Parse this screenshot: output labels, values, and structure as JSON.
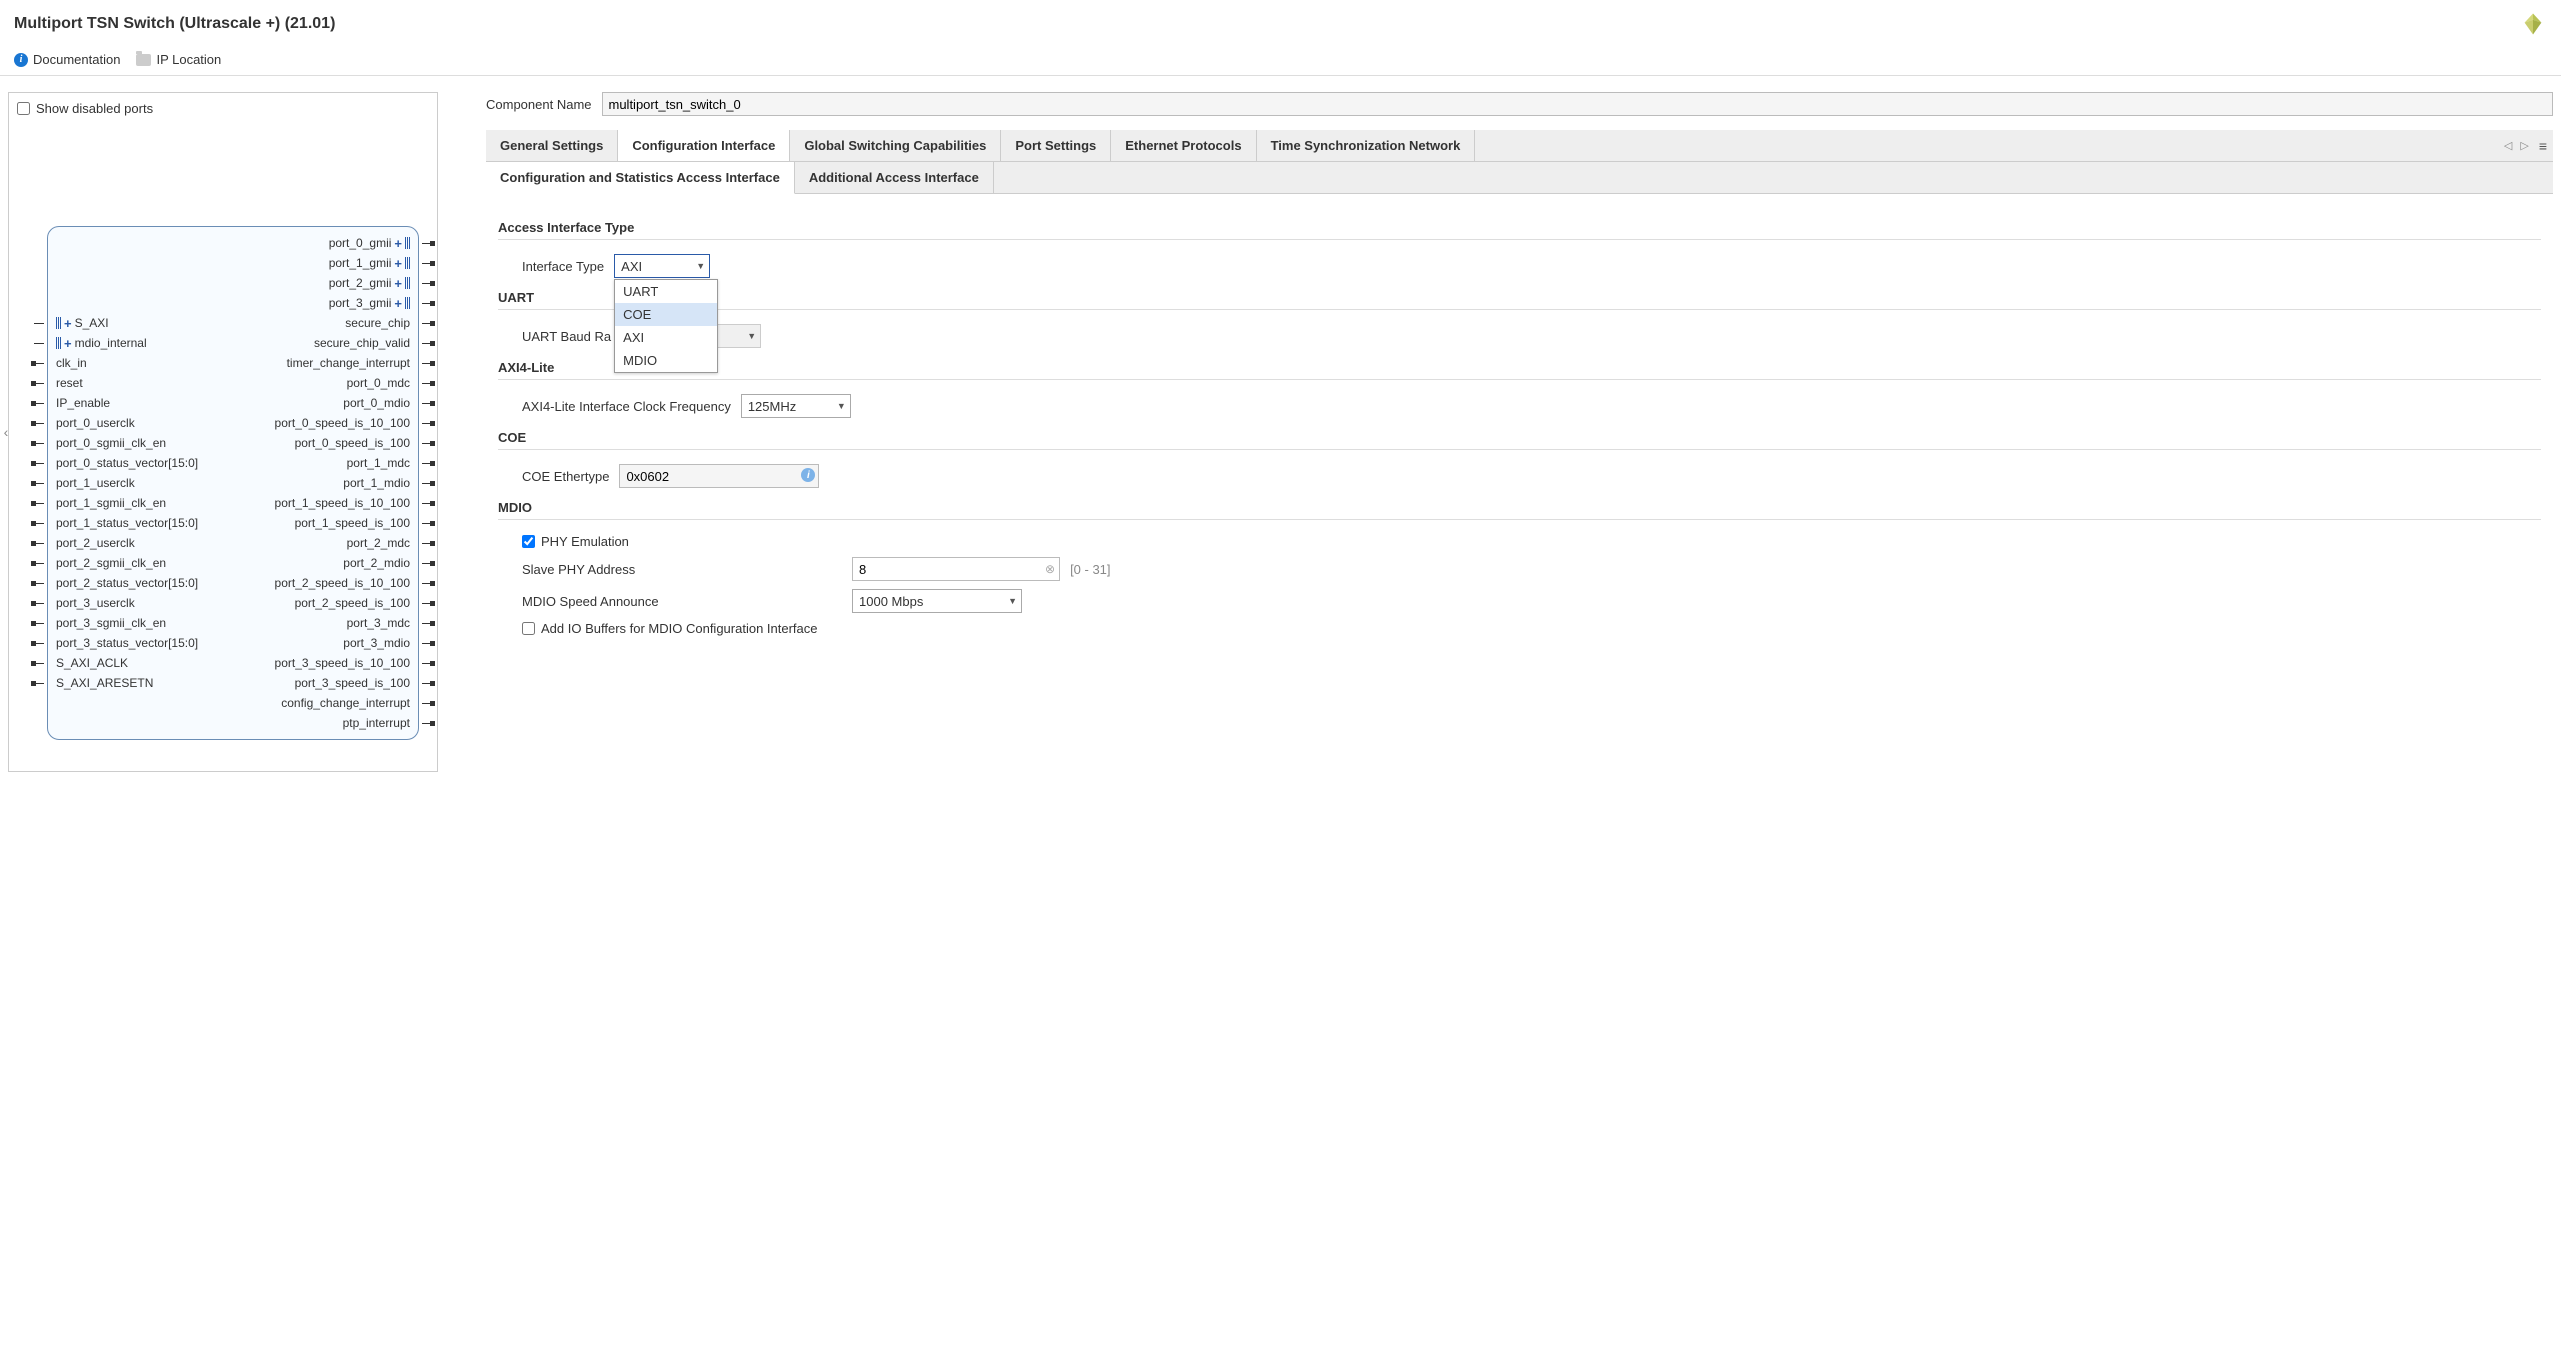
{
  "header": {
    "title": "Multiport TSN Switch (Ultrascale +) (21.01)"
  },
  "toolbar": {
    "documentation": "Documentation",
    "ip_location": "IP Location"
  },
  "left_panel": {
    "show_disabled_label": "Show disabled ports",
    "block_ports": {
      "right_top": [
        "port_0_gmii",
        "port_1_gmii",
        "port_2_gmii",
        "port_3_gmii"
      ],
      "rows": [
        {
          "left": "S_AXI",
          "left_plus": true,
          "left_bus": true,
          "right": "secure_chip"
        },
        {
          "left": "mdio_internal",
          "left_plus": true,
          "left_bus": true,
          "right": "secure_chip_valid"
        },
        {
          "left": "clk_in",
          "right": "timer_change_interrupt"
        },
        {
          "left": "reset",
          "right": "port_0_mdc"
        },
        {
          "left": "IP_enable",
          "right": "port_0_mdio"
        },
        {
          "left": "port_0_userclk",
          "right": "port_0_speed_is_10_100"
        },
        {
          "left": "port_0_sgmii_clk_en",
          "right": "port_0_speed_is_100"
        },
        {
          "left": "port_0_status_vector[15:0]",
          "right": "port_1_mdc"
        },
        {
          "left": "port_1_userclk",
          "right": "port_1_mdio"
        },
        {
          "left": "port_1_sgmii_clk_en",
          "right": "port_1_speed_is_10_100"
        },
        {
          "left": "port_1_status_vector[15:0]",
          "right": "port_1_speed_is_100"
        },
        {
          "left": "port_2_userclk",
          "right": "port_2_mdc"
        },
        {
          "left": "port_2_sgmii_clk_en",
          "right": "port_2_mdio"
        },
        {
          "left": "port_2_status_vector[15:0]",
          "right": "port_2_speed_is_10_100"
        },
        {
          "left": "port_3_userclk",
          "right": "port_2_speed_is_100"
        },
        {
          "left": "port_3_sgmii_clk_en",
          "right": "port_3_mdc"
        },
        {
          "left": "port_3_status_vector[15:0]",
          "right": "port_3_mdio"
        },
        {
          "left": "S_AXI_ACLK",
          "right": "port_3_speed_is_10_100"
        },
        {
          "left": "S_AXI_ARESETN",
          "left_dot": true,
          "right": "port_3_speed_is_100"
        },
        {
          "left": "",
          "right": "config_change_interrupt"
        },
        {
          "left": "",
          "right": "ptp_interrupt"
        }
      ]
    }
  },
  "right_panel": {
    "component_name_label": "Component Name",
    "component_name_value": "multiport_tsn_switch_0",
    "main_tabs": [
      "General Settings",
      "Configuration Interface",
      "Global Switching Capabilities",
      "Port Settings",
      "Ethernet Protocols",
      "Time Synchronization Network"
    ],
    "main_tab_active": 1,
    "sub_tabs": [
      "Configuration and Statistics Access Interface",
      "Additional Access Interface"
    ],
    "sub_tab_active": 0,
    "sections": {
      "access_interface": {
        "title": "Access Interface Type",
        "interface_type_label": "Interface Type",
        "interface_type_value": "AXI",
        "dropdown_options": [
          "UART",
          "COE",
          "AXI",
          "MDIO"
        ],
        "dropdown_highlight": "COE"
      },
      "uart": {
        "title": "UART",
        "baud_label": "UART Baud Ra",
        "baud_value": ""
      },
      "axi4": {
        "title": "AXI4-Lite",
        "clock_label": "AXI4-Lite Interface Clock Frequency",
        "clock_value": "125MHz"
      },
      "coe": {
        "title": "COE",
        "ethertype_label": "COE Ethertype",
        "ethertype_value": "0x0602"
      },
      "mdio": {
        "title": "MDIO",
        "phy_emulation_label": "PHY Emulation",
        "phy_emulation_checked": true,
        "slave_phy_label": "Slave PHY Address",
        "slave_phy_value": "8",
        "slave_phy_range": "[0 - 31]",
        "speed_label": "MDIO Speed Announce",
        "speed_value": "1000 Mbps",
        "io_buffers_label": "Add IO Buffers for MDIO Configuration Interface",
        "io_buffers_checked": false
      }
    }
  }
}
